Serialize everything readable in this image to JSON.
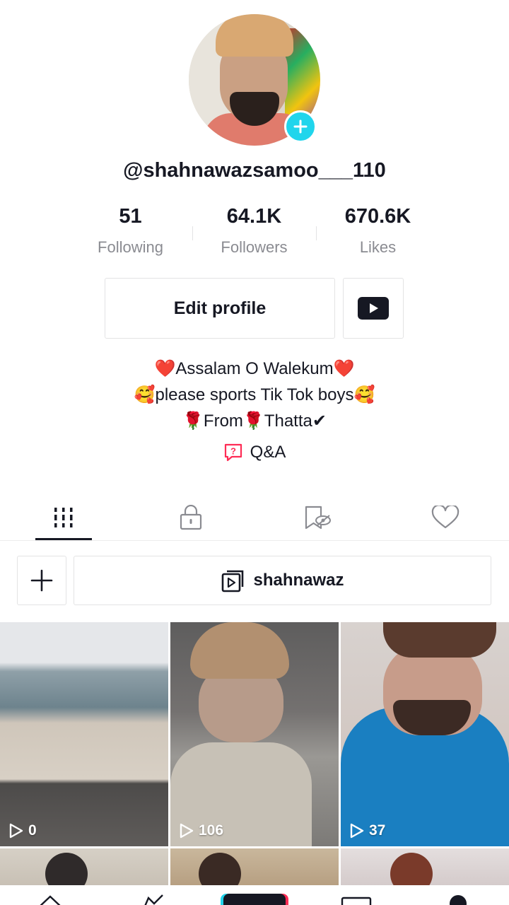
{
  "profile": {
    "username": "@shahnawazsamoo___110",
    "stats": [
      {
        "value": "51",
        "label": "Following"
      },
      {
        "value": "64.1K",
        "label": "Followers"
      },
      {
        "value": "670.6K",
        "label": "Likes"
      }
    ],
    "edit_label": "Edit profile",
    "bio": [
      "❤️Assalam O Walekum❤️",
      "🥰please sports Tik Tok boys🥰",
      "🌹From🌹Thatta✔"
    ],
    "qa_label": "Q&A"
  },
  "tabs": [
    {
      "icon": "grid-icon",
      "active": true
    },
    {
      "icon": "lock-icon",
      "active": false
    },
    {
      "icon": "bookmark-hidden-icon",
      "active": false
    },
    {
      "icon": "heart-outline-icon",
      "active": false
    }
  ],
  "playlist": {
    "name": "shahnawaz"
  },
  "videos": [
    {
      "views": "0"
    },
    {
      "views": "106"
    },
    {
      "views": "37"
    }
  ],
  "colors": {
    "accent": "#20d5ec",
    "text": "#161823",
    "muted": "#8a8b91",
    "qa_pink": "#fe2c55"
  }
}
